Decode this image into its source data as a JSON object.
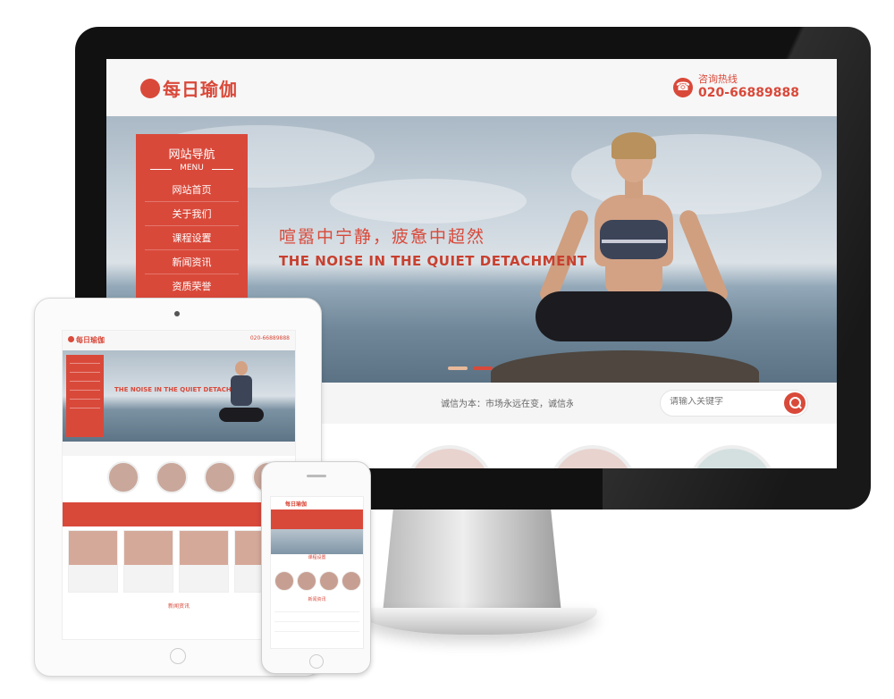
{
  "site": {
    "logo_text": "每日瑜伽",
    "hotline_label": "咨询热线",
    "hotline_number": "020-66889888"
  },
  "nav": {
    "title": "网站导航",
    "subtitle": "MENU",
    "items": [
      "网站首页",
      "关于我们",
      "课程设置",
      "新闻资讯",
      "资质荣誉"
    ]
  },
  "banner": {
    "slogan_cn": "喧嚣中宁静，疲惫中超然",
    "slogan_en": "THE NOISE IN THE QUIET DETACHMENT"
  },
  "notice": {
    "text": "诚信为本：市场永远在变，诚信永远"
  },
  "search": {
    "placeholder": "请输入关键字"
  },
  "colors": {
    "accent": "#d9493a",
    "header_bg": "#f7f7f7",
    "bezel": "#111111"
  },
  "icons": [
    "phone-icon",
    "search-icon"
  ]
}
